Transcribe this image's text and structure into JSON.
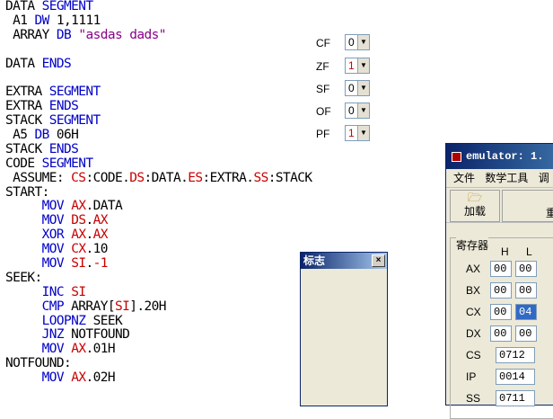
{
  "code_lines": [
    [
      {
        "t": "DATA ",
        "c": "plain"
      },
      {
        "t": "SEGMENT",
        "c": "kw"
      }
    ],
    [
      {
        "t": " A1 ",
        "c": "plain"
      },
      {
        "t": "DW",
        "c": "kw"
      },
      {
        "t": " 1,1111",
        "c": "plain"
      }
    ],
    [
      {
        "t": " ARRAY ",
        "c": "plain"
      },
      {
        "t": "DB",
        "c": "kw"
      },
      {
        "t": " \"asdas dads\"",
        "c": "str"
      }
    ],
    [],
    [
      {
        "t": "DATA ",
        "c": "plain"
      },
      {
        "t": "ENDS",
        "c": "kw"
      }
    ],
    [],
    [
      {
        "t": "EXTRA ",
        "c": "plain"
      },
      {
        "t": "SEGMENT",
        "c": "kw"
      }
    ],
    [
      {
        "t": "EXTRA ",
        "c": "plain"
      },
      {
        "t": "ENDS",
        "c": "kw"
      }
    ],
    [
      {
        "t": "STACK ",
        "c": "plain"
      },
      {
        "t": "SEGMENT",
        "c": "kw"
      }
    ],
    [
      {
        "t": " A5 ",
        "c": "plain"
      },
      {
        "t": "DB",
        "c": "kw"
      },
      {
        "t": " 06H",
        "c": "plain"
      }
    ],
    [
      {
        "t": "STACK ",
        "c": "plain"
      },
      {
        "t": "ENDS",
        "c": "kw"
      }
    ],
    [
      {
        "t": "CODE ",
        "c": "plain"
      },
      {
        "t": "SEGMENT",
        "c": "kw"
      }
    ],
    [
      {
        "t": " ASSUME: ",
        "c": "plain"
      },
      {
        "t": "CS",
        "c": "reg"
      },
      {
        "t": ":CODE.",
        "c": "plain"
      },
      {
        "t": "DS",
        "c": "reg"
      },
      {
        "t": ":DATA.",
        "c": "plain"
      },
      {
        "t": "ES",
        "c": "reg"
      },
      {
        "t": ":EXTRA.",
        "c": "plain"
      },
      {
        "t": "SS",
        "c": "reg"
      },
      {
        "t": ":STACK",
        "c": "plain"
      }
    ],
    [
      {
        "t": "START:",
        "c": "plain"
      }
    ],
    [
      {
        "t": "     ",
        "c": "plain"
      },
      {
        "t": "MOV",
        "c": "kw"
      },
      {
        "t": " ",
        "c": "plain"
      },
      {
        "t": "AX",
        "c": "reg"
      },
      {
        "t": ".DATA",
        "c": "plain"
      }
    ],
    [
      {
        "t": "     ",
        "c": "plain"
      },
      {
        "t": "MOV",
        "c": "kw"
      },
      {
        "t": " ",
        "c": "plain"
      },
      {
        "t": "DS",
        "c": "reg"
      },
      {
        "t": ".",
        "c": "plain"
      },
      {
        "t": "AX",
        "c": "reg"
      }
    ],
    [
      {
        "t": "     ",
        "c": "plain"
      },
      {
        "t": "XOR",
        "c": "kw"
      },
      {
        "t": " ",
        "c": "plain"
      },
      {
        "t": "AX",
        "c": "reg"
      },
      {
        "t": ".",
        "c": "plain"
      },
      {
        "t": "AX",
        "c": "reg"
      }
    ],
    [
      {
        "t": "     ",
        "c": "plain"
      },
      {
        "t": "MOV",
        "c": "kw"
      },
      {
        "t": " ",
        "c": "plain"
      },
      {
        "t": "CX",
        "c": "reg"
      },
      {
        "t": ".10",
        "c": "plain"
      }
    ],
    [
      {
        "t": "     ",
        "c": "plain"
      },
      {
        "t": "MOV",
        "c": "kw"
      },
      {
        "t": " ",
        "c": "plain"
      },
      {
        "t": "SI",
        "c": "reg"
      },
      {
        "t": ".",
        "c": "plain"
      },
      {
        "t": "-1",
        "c": "reg"
      }
    ],
    [
      {
        "t": "SEEK:",
        "c": "plain"
      }
    ],
    [
      {
        "t": "     ",
        "c": "plain"
      },
      {
        "t": "INC",
        "c": "kw"
      },
      {
        "t": " ",
        "c": "plain"
      },
      {
        "t": "SI",
        "c": "reg"
      }
    ],
    [
      {
        "t": "     ",
        "c": "plain"
      },
      {
        "t": "CMP",
        "c": "kw"
      },
      {
        "t": " ARRAY[",
        "c": "plain"
      },
      {
        "t": "SI",
        "c": "reg"
      },
      {
        "t": "].20H",
        "c": "plain"
      }
    ],
    [
      {
        "t": "     ",
        "c": "plain"
      },
      {
        "t": "LOOPNZ",
        "c": "kw"
      },
      {
        "t": " SEEK",
        "c": "plain"
      }
    ],
    [
      {
        "t": "     ",
        "c": "plain"
      },
      {
        "t": "JNZ",
        "c": "kw"
      },
      {
        "t": " NOTFOUND",
        "c": "plain"
      }
    ],
    [
      {
        "t": "     ",
        "c": "plain"
      },
      {
        "t": "MOV",
        "c": "kw"
      },
      {
        "t": " ",
        "c": "plain"
      },
      {
        "t": "AX",
        "c": "reg"
      },
      {
        "t": ".01H",
        "c": "plain"
      }
    ],
    [
      {
        "t": "NOTFOUND:",
        "c": "plain"
      }
    ],
    [
      {
        "t": "     ",
        "c": "plain"
      },
      {
        "t": "MOV",
        "c": "kw"
      },
      {
        "t": " ",
        "c": "plain"
      },
      {
        "t": "AX",
        "c": "reg"
      },
      {
        "t": ".02H",
        "c": "plain"
      }
    ]
  ],
  "flags_window": {
    "title": "标志",
    "close": "×",
    "flags": [
      {
        "name": "CF",
        "value": "0"
      },
      {
        "name": "ZF",
        "value": "1"
      },
      {
        "name": "SF",
        "value": "0"
      },
      {
        "name": "OF",
        "value": "0"
      },
      {
        "name": "PF",
        "value": "1"
      }
    ],
    "arrow": "▼"
  },
  "emulator_window": {
    "title": "emulator: 1.",
    "menu": [
      "文件",
      "数学工具",
      "调"
    ],
    "load_label": "加载",
    "reload_label_partial": "重",
    "registers_title": "寄存器",
    "col_h": "H",
    "col_l": "L",
    "byte_registers": [
      {
        "name": "AX",
        "h": "00",
        "l": "00"
      },
      {
        "name": "BX",
        "h": "00",
        "l": "00"
      },
      {
        "name": "CX",
        "h": "00",
        "l": "04"
      },
      {
        "name": "DX",
        "h": "00",
        "l": "00"
      }
    ],
    "word_registers": [
      {
        "name": "CS",
        "value": "0712"
      },
      {
        "name": "IP",
        "value": "0014"
      },
      {
        "name": "SS",
        "value": "0711"
      }
    ]
  },
  "colors": {
    "keyword": "#0000c8",
    "register": "#c80000",
    "string": "#8a008a",
    "titlebar": "#0a246a"
  }
}
